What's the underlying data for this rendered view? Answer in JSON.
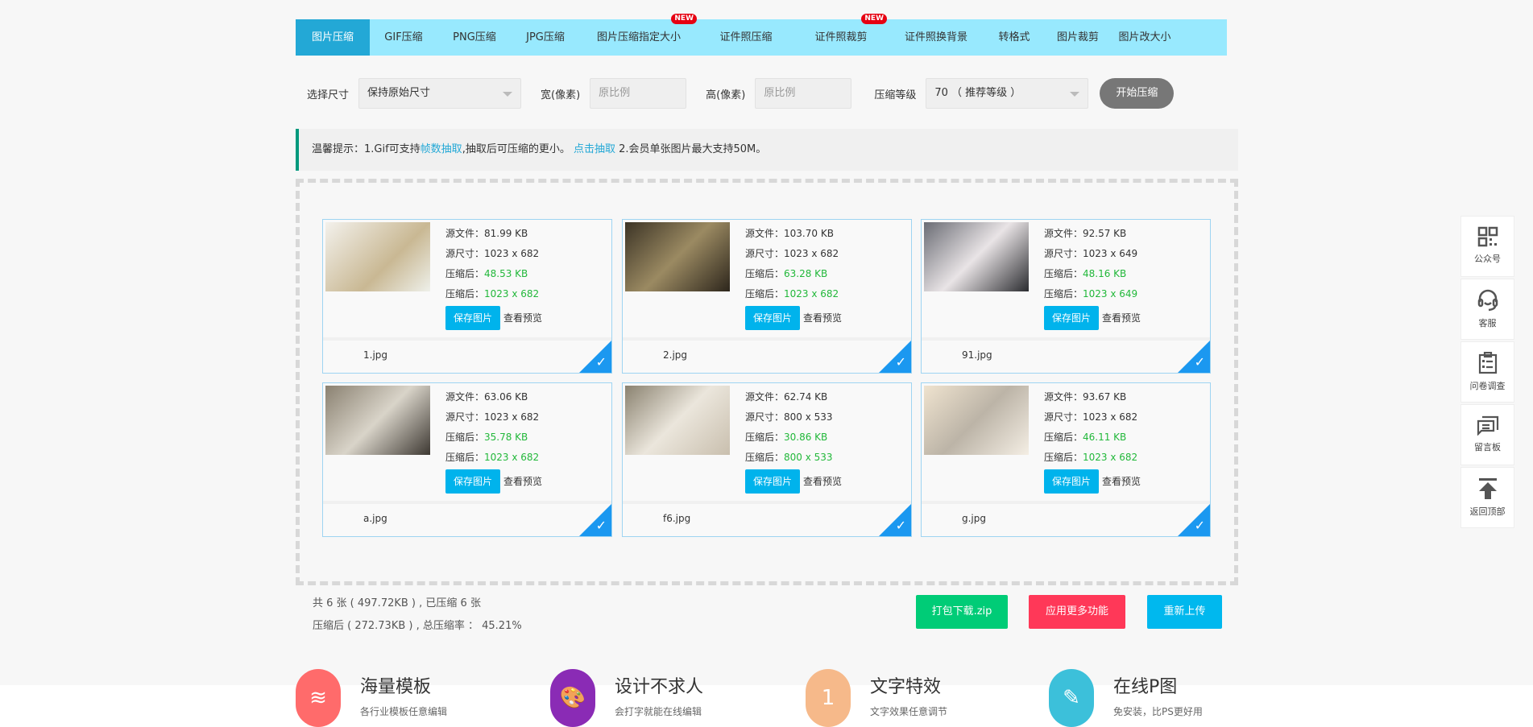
{
  "tabs": [
    {
      "label": "图片压缩",
      "active": true
    },
    {
      "label": "GIF压缩"
    },
    {
      "label": "PNG压缩"
    },
    {
      "label": "JPG压缩"
    },
    {
      "label": "图片压缩指定大小",
      "badge": "NEW"
    },
    {
      "label": "证件照压缩"
    },
    {
      "label": "证件照裁剪",
      "badge": "NEW"
    },
    {
      "label": "证件照换背景"
    },
    {
      "label": "转格式"
    },
    {
      "label": "图片裁剪"
    },
    {
      "label": "图片改大小"
    }
  ],
  "controls": {
    "size_label": "选择尺寸",
    "size_value": "保持原始尺寸",
    "width_label": "宽(像素)",
    "width_placeholder": "原比例",
    "height_label": "高(像素)",
    "height_placeholder": "原比例",
    "level_label": "压缩等级",
    "level_value": "70 （ 推荐等级 ）",
    "start": "开始压缩"
  },
  "tip": {
    "prefix": "温馨提示：1.Gif可支持",
    "link1": "帧数抽取",
    "mid": ",抽取后可压缩的更小。 ",
    "link2": "点击抽取",
    "suffix": " 2.会员单张图片最大支持50M。"
  },
  "labels": {
    "src_file": "源文件：",
    "src_size": "源尺寸：",
    "after": "压缩后：",
    "save": "保存图片",
    "preview": "查看预览"
  },
  "files": [
    {
      "name": "1.jpg",
      "src_file": "81.99 KB",
      "src_size": "1023 x 682",
      "after_file": "48.53 KB",
      "after_size": "1023 x 682"
    },
    {
      "name": "2.jpg",
      "src_file": "103.70 KB",
      "src_size": "1023 x 682",
      "after_file": "63.28 KB",
      "after_size": "1023 x 682"
    },
    {
      "name": "91.jpg",
      "src_file": "92.57 KB",
      "src_size": "1023 x 649",
      "after_file": "48.16 KB",
      "after_size": "1023 x 649"
    },
    {
      "name": "a.jpg",
      "src_file": "63.06 KB",
      "src_size": "1023 x 682",
      "after_file": "35.78 KB",
      "after_size": "1023 x 682"
    },
    {
      "name": "f6.jpg",
      "src_file": "62.74 KB",
      "src_size": "800 x 533",
      "after_file": "30.86 KB",
      "after_size": "800 x 533"
    },
    {
      "name": "g.jpg",
      "src_file": "93.67 KB",
      "src_size": "1023 x 682",
      "after_file": "46.11 KB",
      "after_size": "1023 x 682"
    }
  ],
  "summary": {
    "line1": "共 6 张 ( 497.72KB ) , 已压缩 6 张",
    "line2": "压缩后 ( 272.73KB ) , 总压缩率 ： 45.21%"
  },
  "actions": {
    "zip": "打包下载.zip",
    "more": "应用更多功能",
    "reupload": "重新上传"
  },
  "colors": {
    "zip": "#00cc77",
    "more": "#ff3858",
    "reupload": "#00b8ee",
    "tab_bar": "#98e9fe",
    "tab_active": "#23a8d6"
  },
  "features": [
    {
      "title": "海量模板",
      "sub": "各行业模板任意编辑",
      "icon": "layers-icon"
    },
    {
      "title": "设计不求人",
      "sub": "会打字就能在线编辑",
      "icon": "palette-icon"
    },
    {
      "title": "文字特效",
      "sub": "文字效果任意调节",
      "icon": "text-effect-icon"
    },
    {
      "title": "在线P图",
      "sub": "免安装，比PS更好用",
      "icon": "pencil-icon"
    }
  ],
  "sidebar": [
    {
      "label": "公众号",
      "icon": "qrcode-icon"
    },
    {
      "label": "客服",
      "icon": "headset-icon"
    },
    {
      "label": "问卷调查",
      "icon": "clipboard-icon"
    },
    {
      "label": "留言板",
      "icon": "message-icon"
    },
    {
      "label": "返回顶部",
      "icon": "back-to-top-icon"
    }
  ]
}
